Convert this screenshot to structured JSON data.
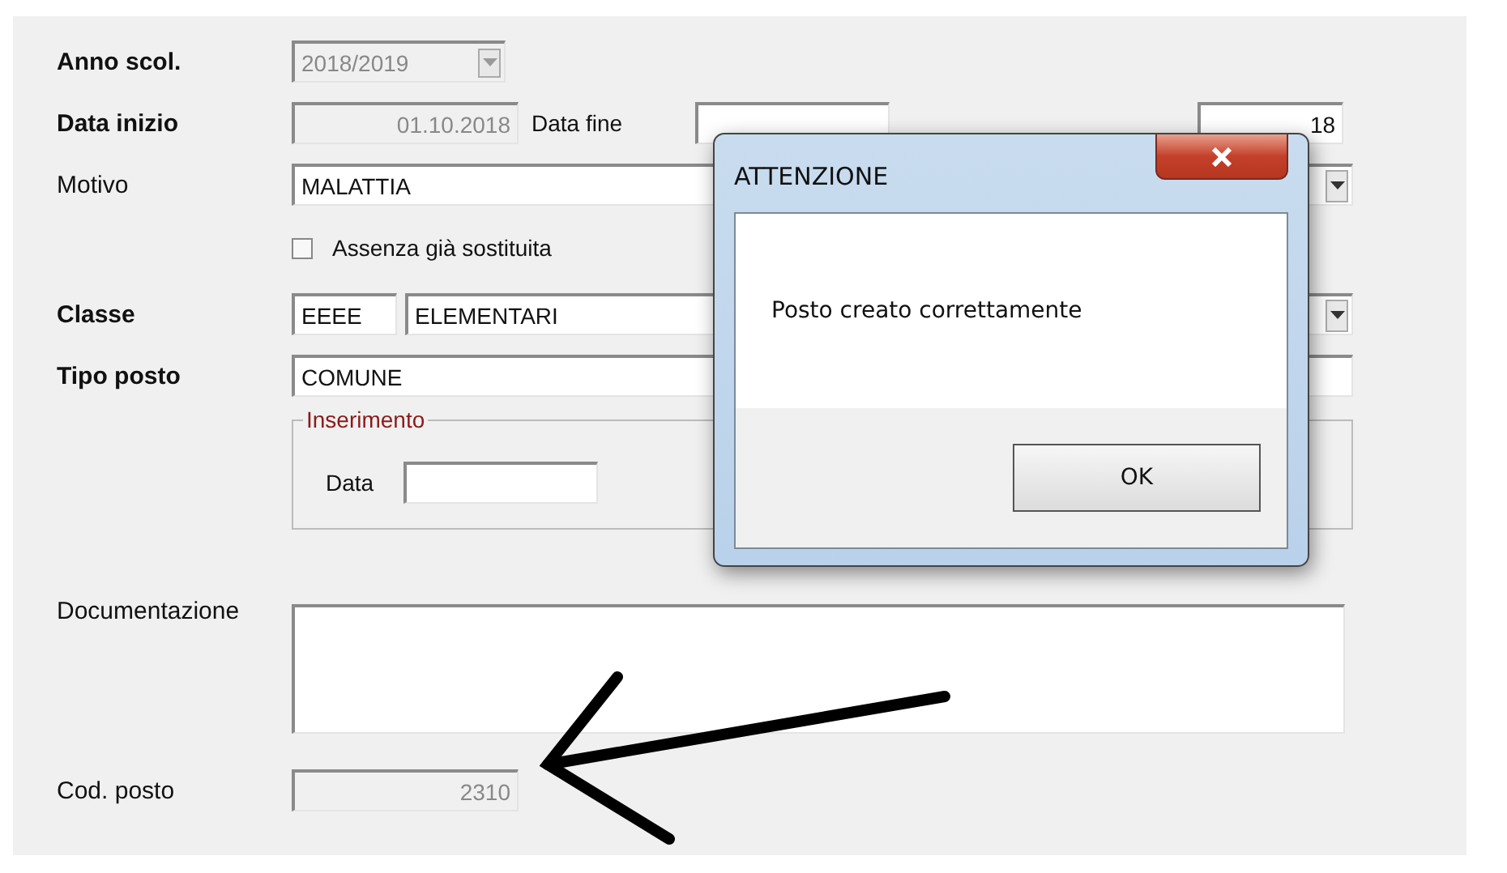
{
  "form": {
    "anno_scol": {
      "label": "Anno scol.",
      "bold": true,
      "value": "2018/2019",
      "disabled": true
    },
    "data_inizio": {
      "label": "Data inizio",
      "bold": true,
      "value": "01.10.2018",
      "disabled": true
    },
    "data_fine": {
      "label": "Data fine"
    },
    "ore_settimanali": {
      "value": "18"
    },
    "motivo": {
      "label": "Motivo",
      "bold": false,
      "value": "MALATTIA",
      "disabled": false
    },
    "assenza": {
      "label": "Assenza già sostituita",
      "checked": false
    },
    "classe": {
      "label": "Classe",
      "bold": true,
      "code": "EEEE",
      "value": "ELEMENTARI",
      "disabled": false
    },
    "tipo_posto": {
      "label": "Tipo posto",
      "bold": true,
      "value": "COMUNE",
      "disabled": false
    },
    "inserimento": {
      "title": "Inserimento",
      "data_label": "Data"
    },
    "documentazione": {
      "label": "Documentazione",
      "bold": false
    },
    "cod_posto": {
      "label": "Cod. posto",
      "bold": false,
      "value": "2310",
      "disabled": true
    }
  },
  "dialog": {
    "title": "ATTENZIONE",
    "message": "Posto creato correttamente",
    "button": "OK"
  }
}
